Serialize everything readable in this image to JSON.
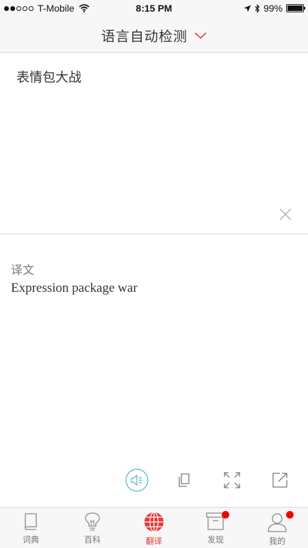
{
  "status_bar": {
    "carrier": "T-Mobile",
    "time": "8:15 PM",
    "battery": "99%",
    "battery_level": 0.99
  },
  "header": {
    "title": "语言自动检测",
    "chevron_icon": "chevron-down-icon",
    "accent_color": "#e33c3c"
  },
  "input": {
    "text": "表情包大战"
  },
  "translation": {
    "label": "译文",
    "text": "Expression package war"
  },
  "actions": [
    {
      "icon": "speaker-icon"
    },
    {
      "icon": "copy-icon"
    },
    {
      "icon": "fullscreen-icon"
    },
    {
      "icon": "share-icon"
    }
  ],
  "tabs": [
    {
      "label": "词典",
      "icon": "book-icon",
      "active": false,
      "badge": false
    },
    {
      "label": "百科",
      "icon": "lightbulb-icon",
      "active": false,
      "badge": false
    },
    {
      "label": "翻译",
      "icon": "globe-icon",
      "active": true,
      "badge": false
    },
    {
      "label": "发现",
      "icon": "archive-icon",
      "active": false,
      "badge": true
    },
    {
      "label": "我的",
      "icon": "person-icon",
      "active": false,
      "badge": true
    }
  ]
}
